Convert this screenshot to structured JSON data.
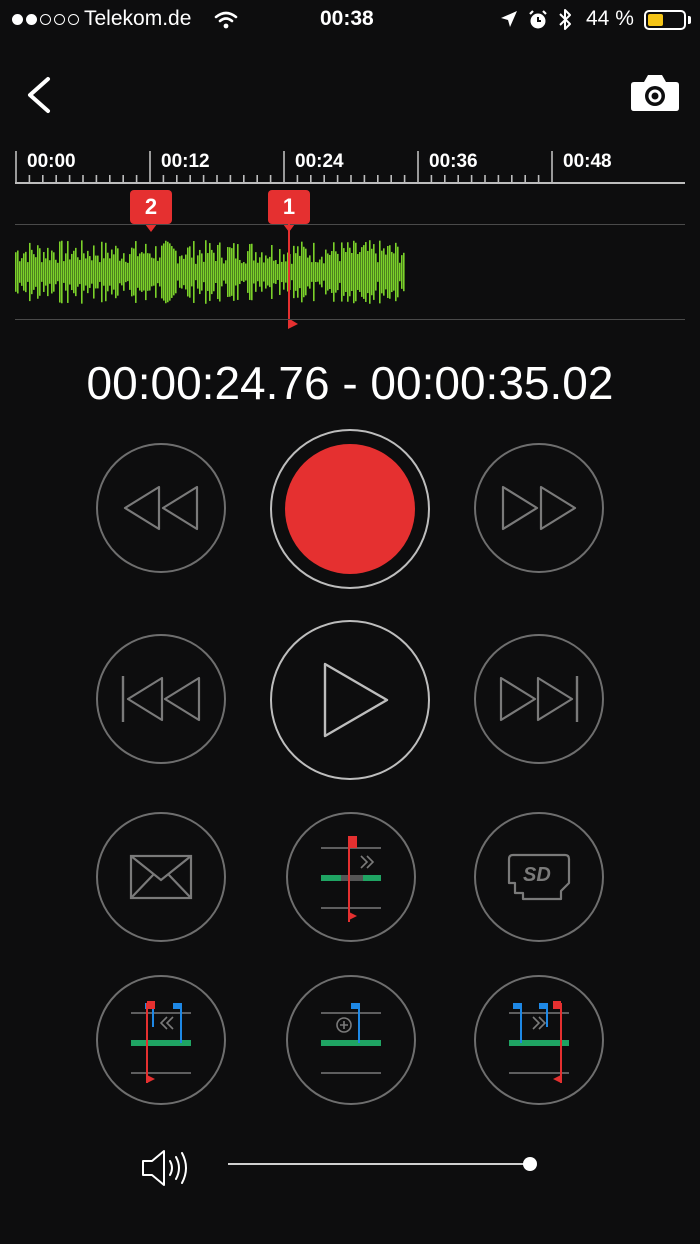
{
  "status_bar": {
    "carrier": "Telekom.de",
    "time": "00:38",
    "battery_percent": "44 %",
    "battery_level": 0.44,
    "signal_dots_filled": 2,
    "signal_dots_total": 5
  },
  "nav": {
    "back_icon": "chevron-left-icon",
    "camera_icon": "camera-icon"
  },
  "timeline": {
    "ticks": [
      "00:00",
      "00:12",
      "00:24",
      "00:36",
      "00:48"
    ],
    "markers": [
      {
        "label": "2",
        "time": "00:08"
      },
      {
        "label": "1",
        "time": "00:24.76"
      }
    ]
  },
  "selection": {
    "range_text": "00:00:24.76 - 00:00:35.02"
  },
  "controls": {
    "rewind": "rewind-icon",
    "record": "record-icon",
    "fast_forward": "fast-forward-icon",
    "skip_back": "skip-back-icon",
    "play": "play-icon",
    "skip_forward": "skip-forward-icon",
    "email": "envelope-icon",
    "jump_marker": "marker-jump-icon",
    "sd_card": "sd-card-icon",
    "move_marker_left": "marker-move-left-icon",
    "add_marker": "marker-add-icon",
    "move_marker_right": "marker-move-right-icon"
  },
  "volume": {
    "icon": "speaker-icon",
    "level": 1.0
  },
  "colors": {
    "background": "#0d0d0e",
    "accent_red": "#e53030",
    "waveform_green": "#7bd12a",
    "marker_blue": "#1e88e5",
    "track_green": "#1fa463"
  }
}
